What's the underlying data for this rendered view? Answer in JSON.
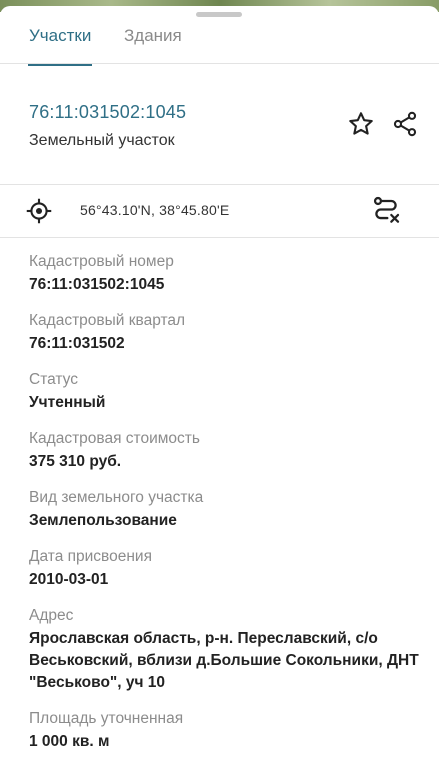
{
  "tabs": [
    {
      "label": "Участки",
      "active": true
    },
    {
      "label": "Здания",
      "active": false
    }
  ],
  "header": {
    "cadastral_link": "76:11:031502:1045",
    "object_type": "Земельный участок"
  },
  "location": {
    "coordinates": "56°43.10'N, 38°45.80'E"
  },
  "colors": {
    "accent": "#2f6f86",
    "label_gray": "#8c8c8c"
  },
  "fields": [
    {
      "label": "Кадастровый номер",
      "value": "76:11:031502:1045"
    },
    {
      "label": "Кадастровый квартал",
      "value": "76:11:031502"
    },
    {
      "label": "Статус",
      "value": "Учтенный"
    },
    {
      "label": "Кадастровая стоимость",
      "value": "375 310 руб."
    },
    {
      "label": "Вид земельного участка",
      "value": "Землепользование"
    },
    {
      "label": "Дата присвоения",
      "value": "2010-03-01"
    },
    {
      "label": "Адрес",
      "value": "Ярославская область, р-н. Переславский, с/о Веськовский, вблизи д.Большие Сокольники, ДНТ \"Веськово\", уч 10"
    },
    {
      "label": "Площадь уточненная",
      "value": "1 000 кв. м"
    }
  ]
}
